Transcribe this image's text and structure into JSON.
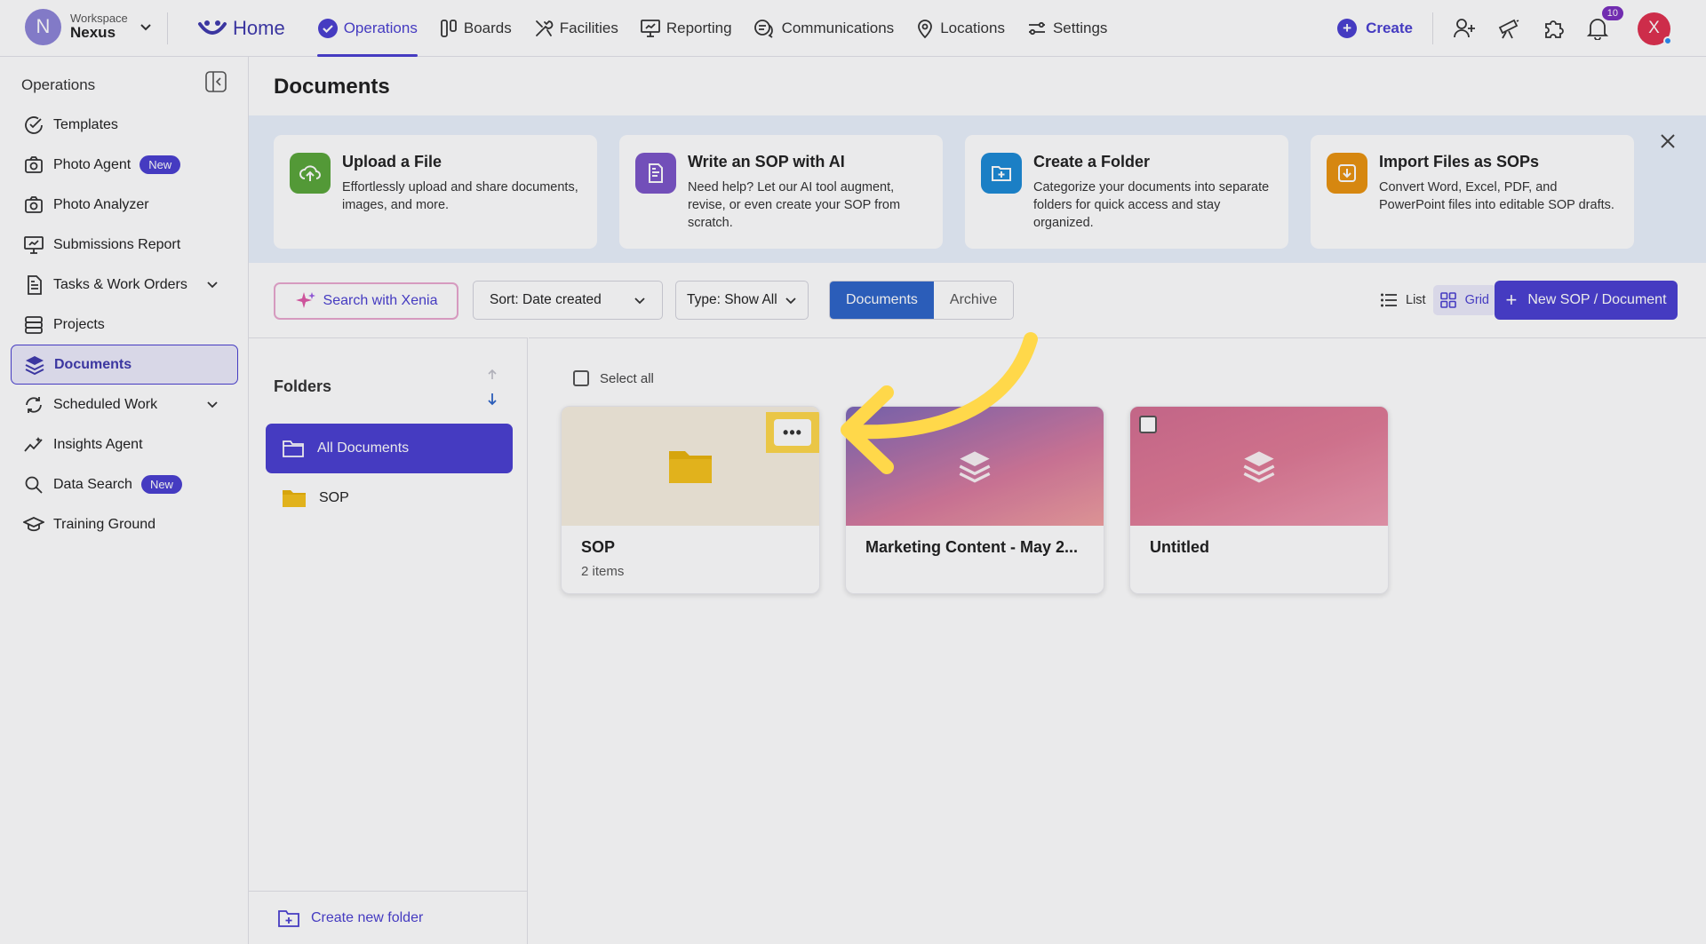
{
  "workspace": {
    "initial": "N",
    "label": "Workspace",
    "name": "Nexus"
  },
  "nav": {
    "home": "Home",
    "items": [
      "Operations",
      "Boards",
      "Facilities",
      "Reporting",
      "Communications",
      "Locations",
      "Settings"
    ],
    "active": "Operations"
  },
  "topright": {
    "create": "Create",
    "notif_count": "10",
    "user_initial": "X"
  },
  "sidebar": {
    "title": "Operations",
    "items": [
      {
        "label": "Templates",
        "icon": "check-circle-icon"
      },
      {
        "label": "Photo Agent",
        "icon": "camera-icon",
        "badge": "New"
      },
      {
        "label": "Photo Analyzer",
        "icon": "camera-icon"
      },
      {
        "label": "Submissions Report",
        "icon": "presentation-icon"
      },
      {
        "label": "Tasks & Work Orders",
        "icon": "document-icon"
      },
      {
        "label": "Projects",
        "icon": "server-icon"
      },
      {
        "label": "Documents",
        "icon": "layers-icon"
      },
      {
        "label": "Scheduled Work",
        "icon": "refresh-icon"
      },
      {
        "label": "Insights Agent",
        "icon": "trend-icon"
      },
      {
        "label": "Data Search",
        "icon": "search-icon",
        "badge": "New"
      },
      {
        "label": "Training Ground",
        "icon": "graduation-cap-icon"
      }
    ]
  },
  "page": {
    "title": "Documents"
  },
  "quick_actions": [
    {
      "title": "Upload a File",
      "desc": "Effortlessly upload and share documents, images, and more.",
      "color": "#5aa63a"
    },
    {
      "title": "Write an SOP with AI",
      "desc": "Need help? Let our AI tool augment, revise, or even create your SOP from scratch.",
      "color": "#7c55c8"
    },
    {
      "title": "Create a Folder",
      "desc": "Categorize your documents into separate folders for quick access and stay organized.",
      "color": "#1c8ad6"
    },
    {
      "title": "Import Files as SOPs",
      "desc": "Convert Word, Excel, PDF, and PowerPoint files into editable SOP drafts.",
      "color": "#e9930f"
    }
  ],
  "toolbar": {
    "xenia": "Search with Xenia",
    "sort": "Sort: Date created",
    "type": "Type: Show All",
    "tab_documents": "Documents",
    "tab_archive": "Archive",
    "view_list": "List",
    "view_grid": "Grid",
    "new_doc": "New SOP / Document"
  },
  "folders": {
    "title": "Folders",
    "all": "All Documents",
    "items": [
      "SOP"
    ],
    "create": "Create new folder"
  },
  "grid": {
    "select_all": "Select all",
    "cards": [
      {
        "title": "SOP",
        "sub": "2 items",
        "type": "folder"
      },
      {
        "title": "Marketing Content - May 2...",
        "type": "document"
      },
      {
        "title": "Untitled",
        "type": "document"
      }
    ],
    "more_label": "•••"
  },
  "colors": {
    "brand": "#4a3fd1",
    "active_tab": "#2e64c9",
    "highlight": "#ffd84a"
  }
}
